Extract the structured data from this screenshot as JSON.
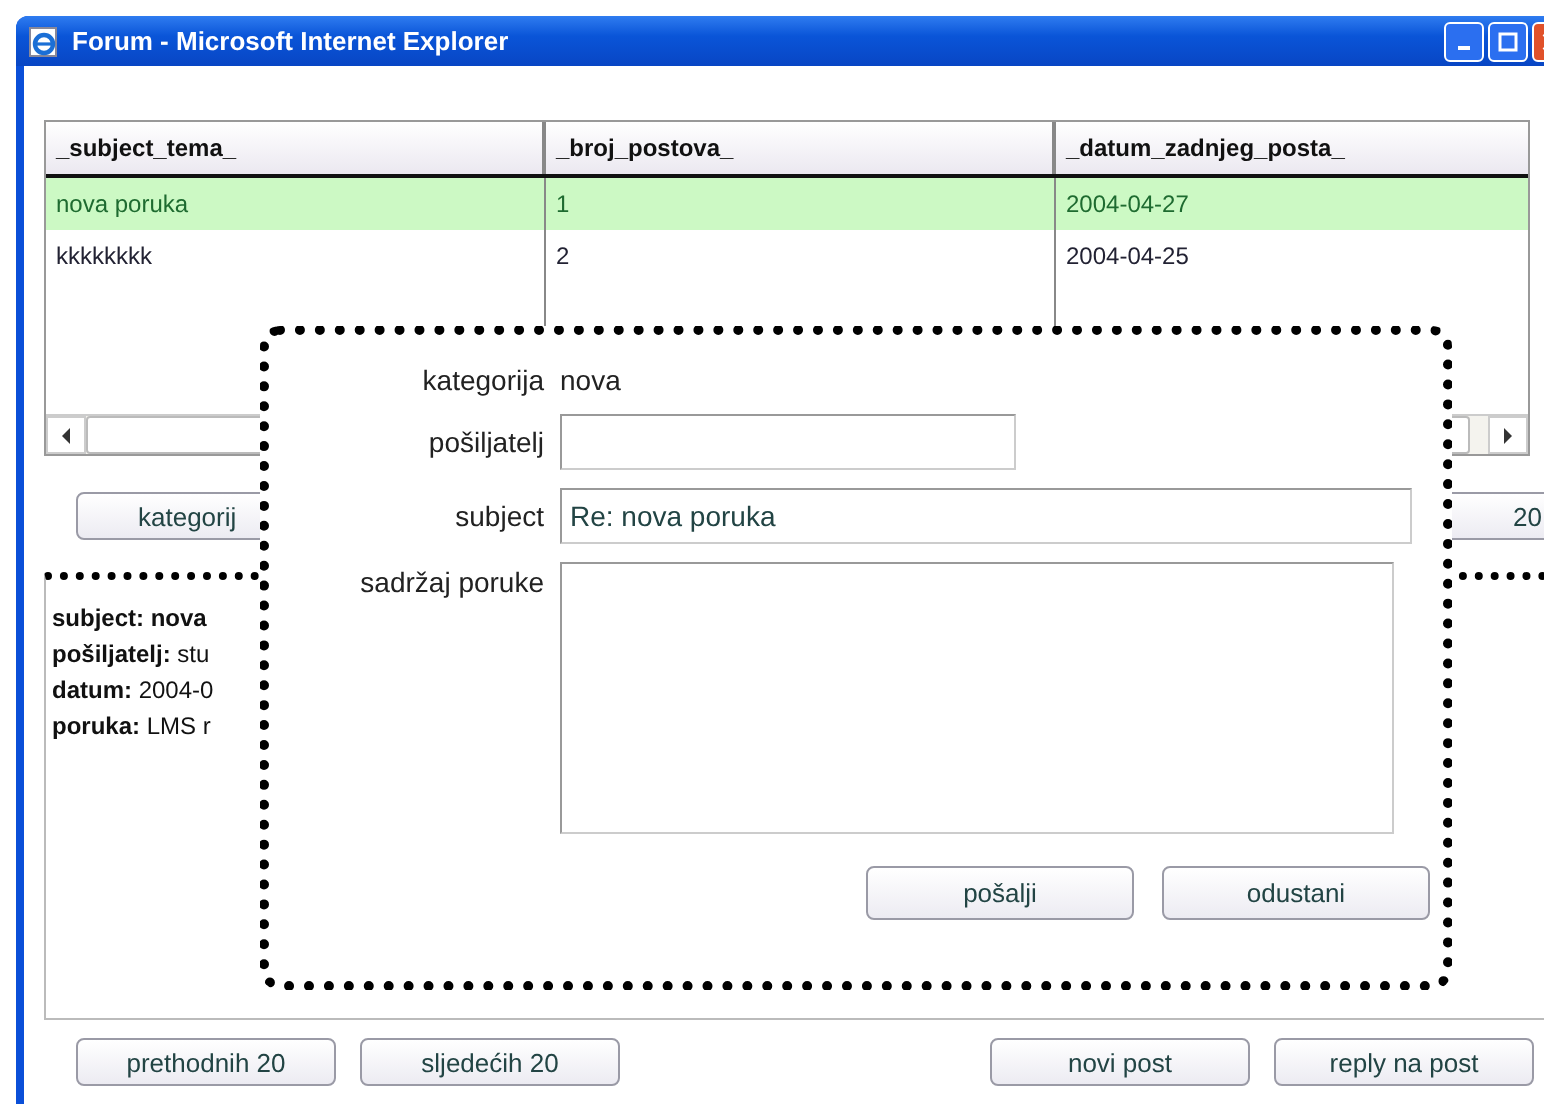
{
  "window": {
    "title": "Forum - Microsoft Internet Explorer"
  },
  "table": {
    "columns": [
      "_subject_tema_",
      "_broj_postova_",
      "_datum_zadnjeg_posta_"
    ],
    "rows": [
      {
        "cells": [
          "nova poruka",
          "1",
          "2004-04-27"
        ],
        "selected": true
      },
      {
        "cells": [
          "kkkkkkkk",
          "2",
          "2004-04-25"
        ],
        "selected": false
      }
    ]
  },
  "list_buttons": [
    "kategorij",
    "20"
  ],
  "detail": {
    "lines": [
      {
        "label": "subject: nova"
      },
      {
        "label": "pošiljatelj:",
        "value": "stu"
      },
      {
        "label": "datum:",
        "value": "2004-0"
      },
      {
        "label": "poruka:",
        "value": "LMS r"
      }
    ]
  },
  "bottom_buttons": [
    "prethodnih 20",
    "sljedećih 20",
    "novi post",
    "reply na post"
  ],
  "dialog": {
    "fields": [
      {
        "kind": "text",
        "label": "kategorija",
        "value": "nova"
      },
      {
        "kind": "short_input",
        "label": "pošiljatelj"
      },
      {
        "kind": "input",
        "label": "subject",
        "value": "Re: nova poruka"
      },
      {
        "kind": "textarea",
        "label": "sadržaj poruke"
      }
    ],
    "buttons": [
      "pošalji",
      "odustani"
    ]
  }
}
